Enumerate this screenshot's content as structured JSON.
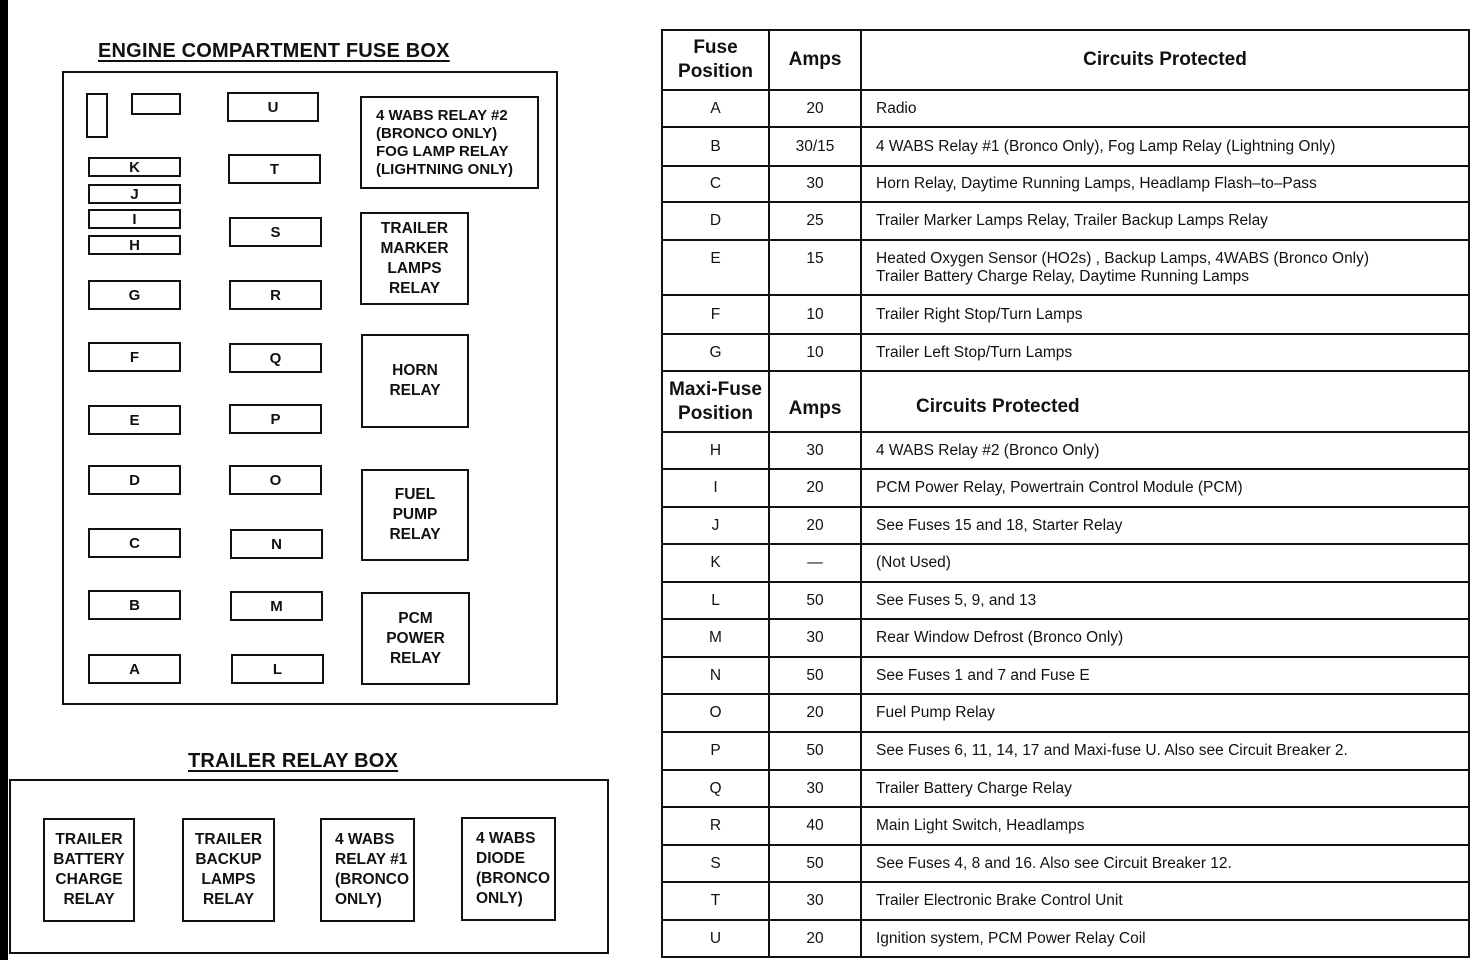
{
  "engine_box": {
    "title": "ENGINE COMPARTMENT FUSE BOX",
    "left_fuses": [
      "K",
      "J",
      "I",
      "H",
      "G",
      "F",
      "E",
      "D",
      "C",
      "B",
      "A"
    ],
    "middle_fuses": [
      "U",
      "T",
      "S",
      "R",
      "Q",
      "P",
      "O",
      "N",
      "M",
      "L"
    ],
    "relays": [
      {
        "label": "4 WABS RELAY  #2\n(BRONCO ONLY)\nFOG LAMP RELAY\n(LIGHTNING ONLY)"
      },
      {
        "label": "TRAILER\nMARKER\nLAMPS\nRELAY"
      },
      {
        "label": "HORN\nRELAY"
      },
      {
        "label": "FUEL\nPUMP\nRELAY"
      },
      {
        "label": "PCM\nPOWER\nRELAY"
      }
    ]
  },
  "trailer_box": {
    "title": "TRAILER RELAY BOX",
    "relays": [
      {
        "label": "TRAILER\nBATTERY\nCHARGE\nRELAY"
      },
      {
        "label": "TRAILER\nBACKUP\nLAMPS\nRELAY"
      },
      {
        "label": "4 WABS\nRELAY  #1\n(BRONCO\nONLY)"
      },
      {
        "label": "4 WABS\nDIODE\n(BRONCO\nONLY)"
      }
    ]
  },
  "fuse_table": {
    "headers": {
      "position": "Fuse Position",
      "amps": "Amps",
      "circuits": "Circuits Protected"
    },
    "rows": [
      {
        "position": "A",
        "amps": "20",
        "circuits": "Radio"
      },
      {
        "position": "B",
        "amps": "30/15",
        "circuits": "4 WABS Relay #1 (Bronco Only), Fog Lamp Relay (Lightning Only)"
      },
      {
        "position": "C",
        "amps": "30",
        "circuits": "Horn Relay, Daytime Running Lamps, Headlamp Flash–to–Pass"
      },
      {
        "position": "D",
        "amps": "25",
        "circuits": "Trailer Marker Lamps Relay, Trailer Backup Lamps Relay"
      },
      {
        "position": "E",
        "amps": "15",
        "circuits": "Heated Oxygen Sensor (HO2s) , Backup Lamps, 4WABS (Bronco Only)",
        "circuits_line2": "Trailer Battery Charge Relay, Daytime Running Lamps"
      },
      {
        "position": "F",
        "amps": "10",
        "circuits": "Trailer Right Stop/Turn Lamps"
      },
      {
        "position": "G",
        "amps": "10",
        "circuits": "Trailer Left Stop/Turn Lamps"
      }
    ]
  },
  "maxi_table": {
    "headers": {
      "position": "Maxi-Fuse Position",
      "amps": "Amps",
      "circuits": "Circuits Protected"
    },
    "rows": [
      {
        "position": "H",
        "amps": "30",
        "circuits": "4 WABS Relay #2 (Bronco Only)"
      },
      {
        "position": "I",
        "amps": "20",
        "circuits": "PCM Power Relay, Powertrain Control Module (PCM)"
      },
      {
        "position": "J",
        "amps": "20",
        "circuits": "See Fuses 15 and 18, Starter Relay"
      },
      {
        "position": "K",
        "amps": "—",
        "circuits": "(Not Used)"
      },
      {
        "position": "L",
        "amps": "50",
        "circuits": "See Fuses 5, 9, and 13"
      },
      {
        "position": "M",
        "amps": "30",
        "circuits": "Rear Window Defrost (Bronco Only)"
      },
      {
        "position": "N",
        "amps": "50",
        "circuits": "See Fuses 1 and 7 and Fuse E"
      },
      {
        "position": "O",
        "amps": "20",
        "circuits": "Fuel Pump Relay"
      },
      {
        "position": "P",
        "amps": "50",
        "circuits": "See Fuses 6, 11, 14, 17 and Maxi-fuse U. Also see Circuit Breaker 2."
      },
      {
        "position": "Q",
        "amps": "30",
        "circuits": "Trailer Battery Charge Relay"
      },
      {
        "position": "R",
        "amps": "40",
        "circuits": "Main Light Switch, Headlamps"
      },
      {
        "position": "S",
        "amps": "50",
        "circuits": "See Fuses 4, 8 and 16. Also see Circuit Breaker 12."
      },
      {
        "position": "T",
        "amps": "30",
        "circuits": "Trailer Electronic Brake Control Unit"
      },
      {
        "position": "U",
        "amps": "20",
        "circuits": "Ignition system, PCM Power Relay Coil"
      }
    ]
  }
}
